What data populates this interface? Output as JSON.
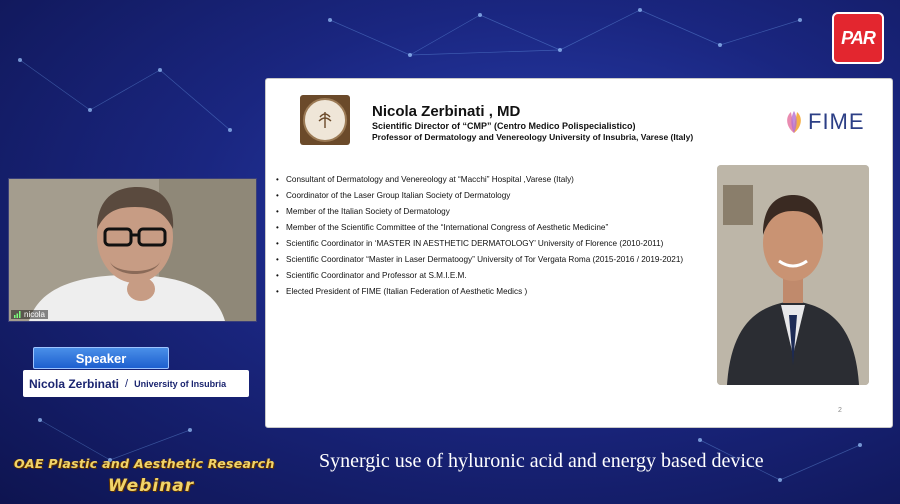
{
  "logo": {
    "text": "PAR"
  },
  "slide": {
    "speaker_name": "Nicola Zerbinati ,  MD",
    "title_line1": "Scientific Director of “CMP” (Centro Medico Polispecialistico)",
    "title_line2": "Professor of Dermatology and Venereology  University of Insubria, Varese (Italy)",
    "fime_logo": "FIME",
    "bullets": [
      "Consultant of Dermatology and Venereology  at “Macchi” Hospital ,Varese (Italy)",
      "Coordinator of the Laser Group  Italian Society of Dermatology",
      "Member of the Italian Society of Dermatology",
      "Member of the Scientific Committee of the “International Congress of Aesthetic Medicine”",
      "Scientific Coordinator in ‘MASTER IN AESTHETIC DERMATOLOGY’ University of Florence (2010-2011)",
      "Scientific Coordinator “Master in Laser Dermatoogy” University of Tor Vergata Roma (2015-2016 / 2019-2021)",
      "Scientific Coordinator and Professor at  S.M.I.E.M.",
      "Elected President of FIME (Italian Federation of Aesthetic Medics )"
    ],
    "page_number": "2"
  },
  "camera": {
    "participant_label": "nicola"
  },
  "speaker": {
    "tag": "Speaker",
    "name": "Nicola Zerbinati",
    "separator": "/",
    "affiliation": "University of Insubria"
  },
  "brand": {
    "line1": "OAE Plastic and Aesthetic Research",
    "line2": "Webinar"
  },
  "topic": "Synergic use of hyluronic acid and energy based device",
  "colors": {
    "accent_red": "#e3262f",
    "background_blue": "#1a2680",
    "brand_gold": "#f1d46a"
  }
}
